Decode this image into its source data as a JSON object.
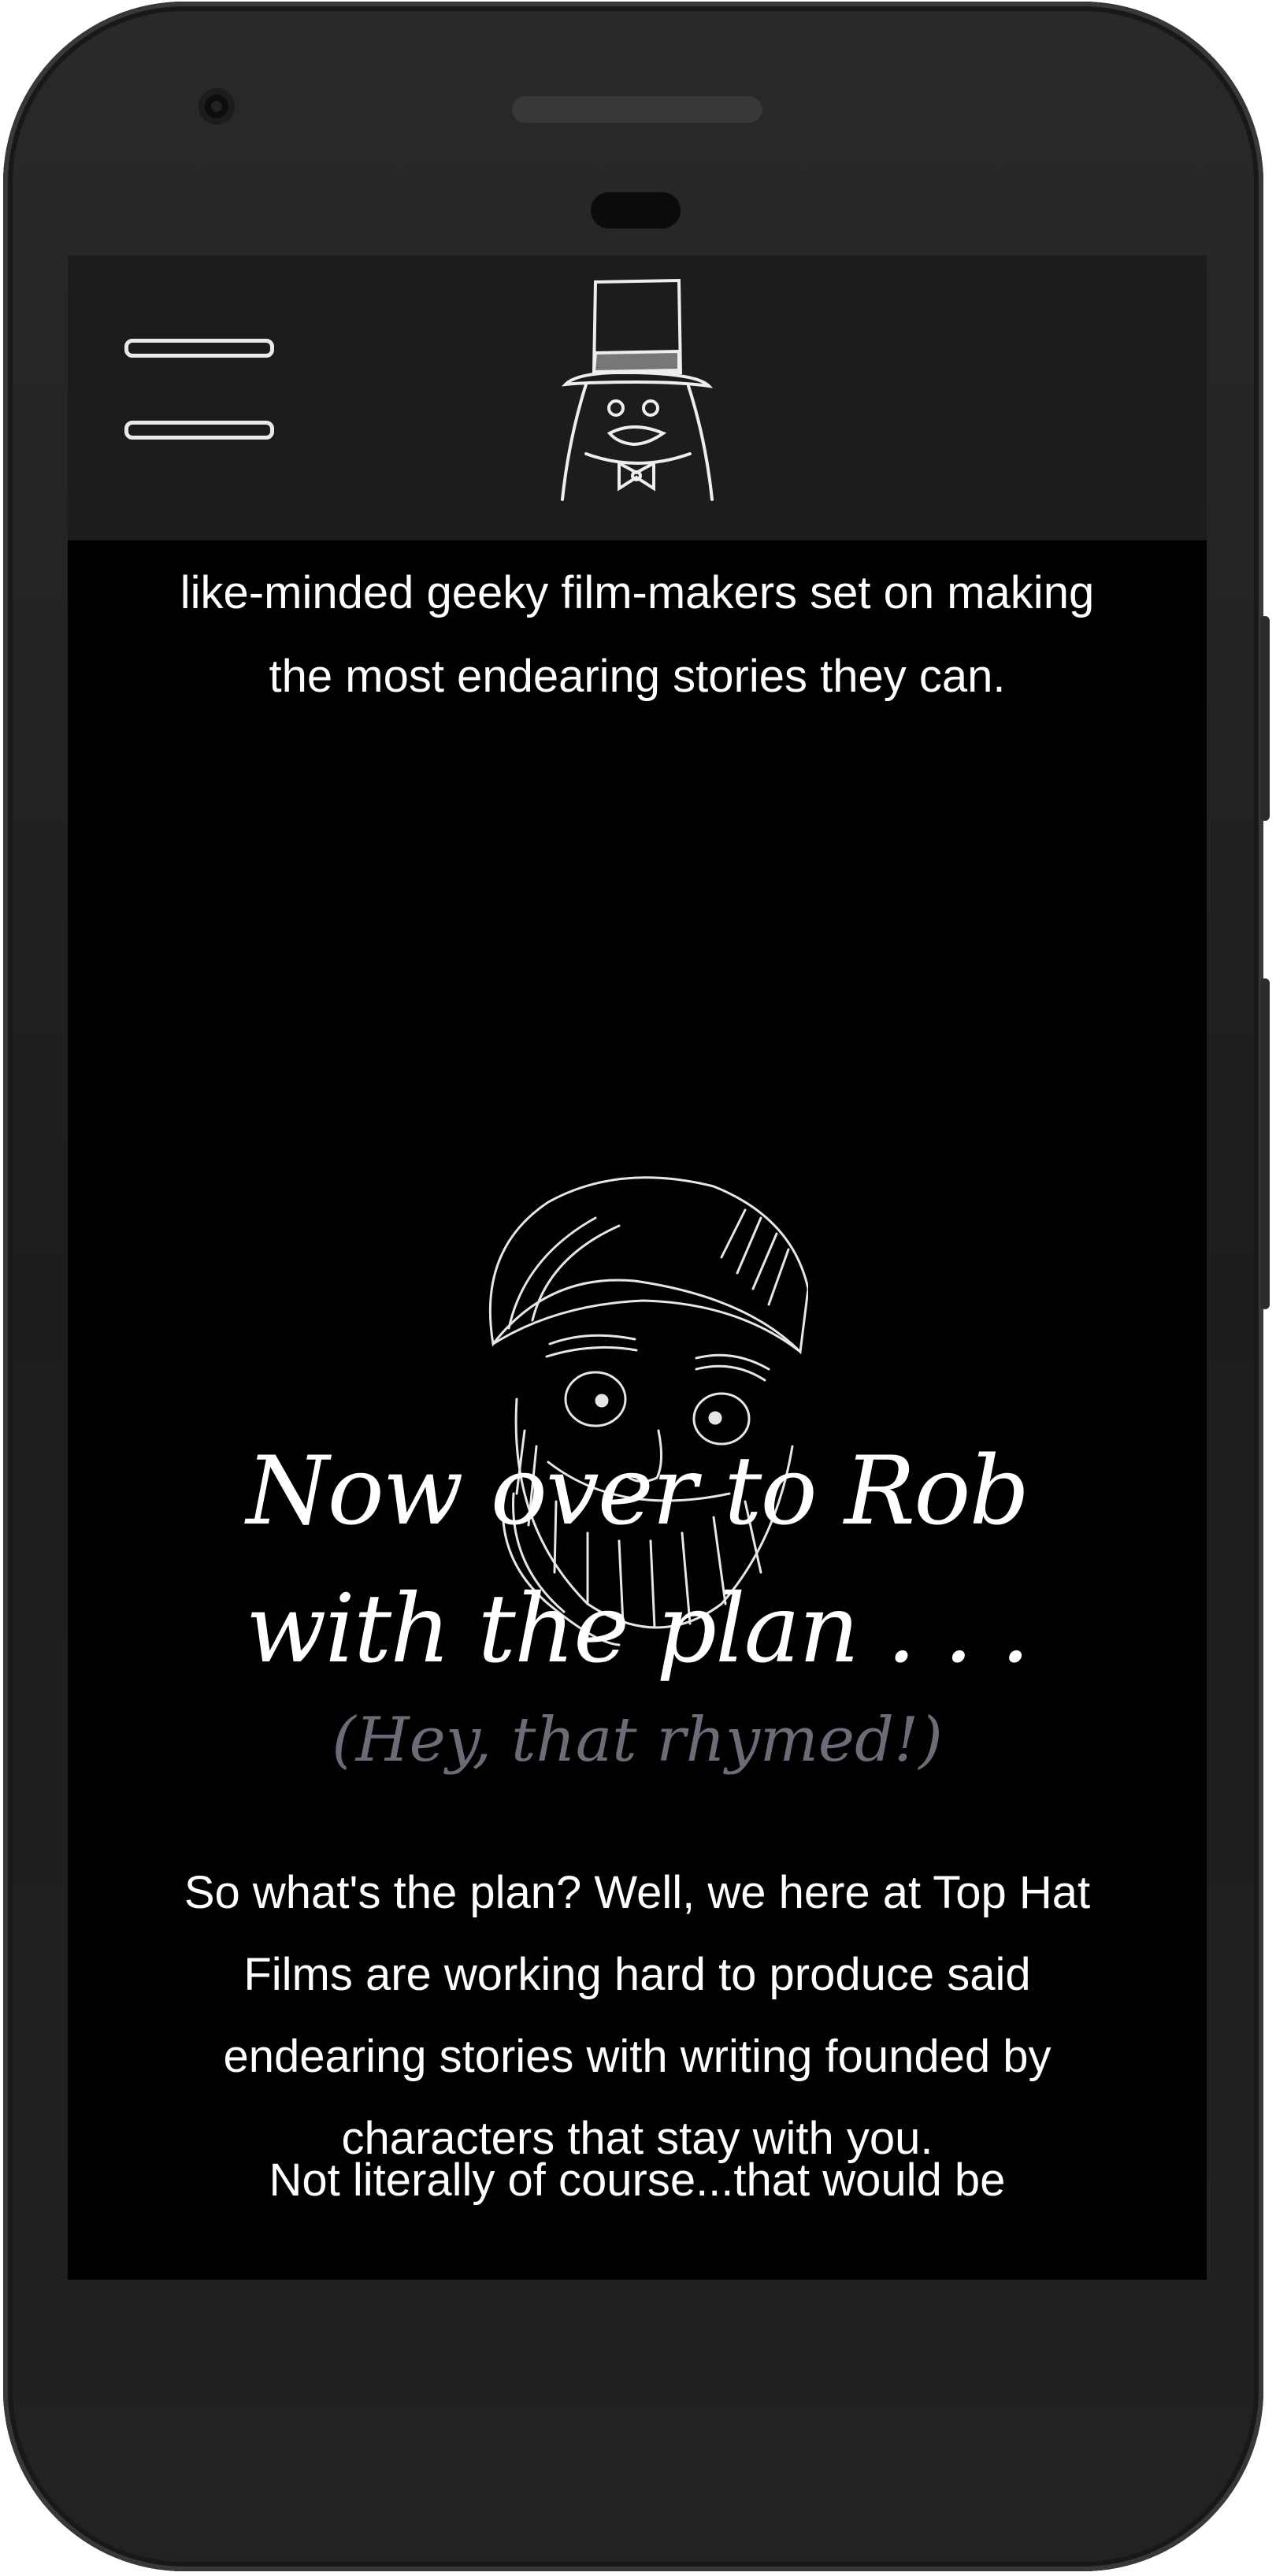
{
  "page": {
    "intro_line1": "like-minded geeky film-makers set on making",
    "intro_line2": "the most endearing stories they can.",
    "heading": "Now over to Rob with the plan . . .",
    "subheading": "(Hey, that rhymed!)",
    "paragraph1": "So what's the plan? Well, we here at Top Hat Films are working hard to produce said endearing stories with writing founded by characters that stay with you.",
    "paragraph2": "Not literally of course...that would be"
  },
  "icons": {
    "menu": "hamburger-menu-icon",
    "logo": "top-hat-logo",
    "portrait": "rob-portrait-illustration"
  },
  "colors": {
    "background": "#000000",
    "header_bar": "#1c1c1c",
    "text": "#ffffff",
    "subheading": "#6e6a78"
  }
}
